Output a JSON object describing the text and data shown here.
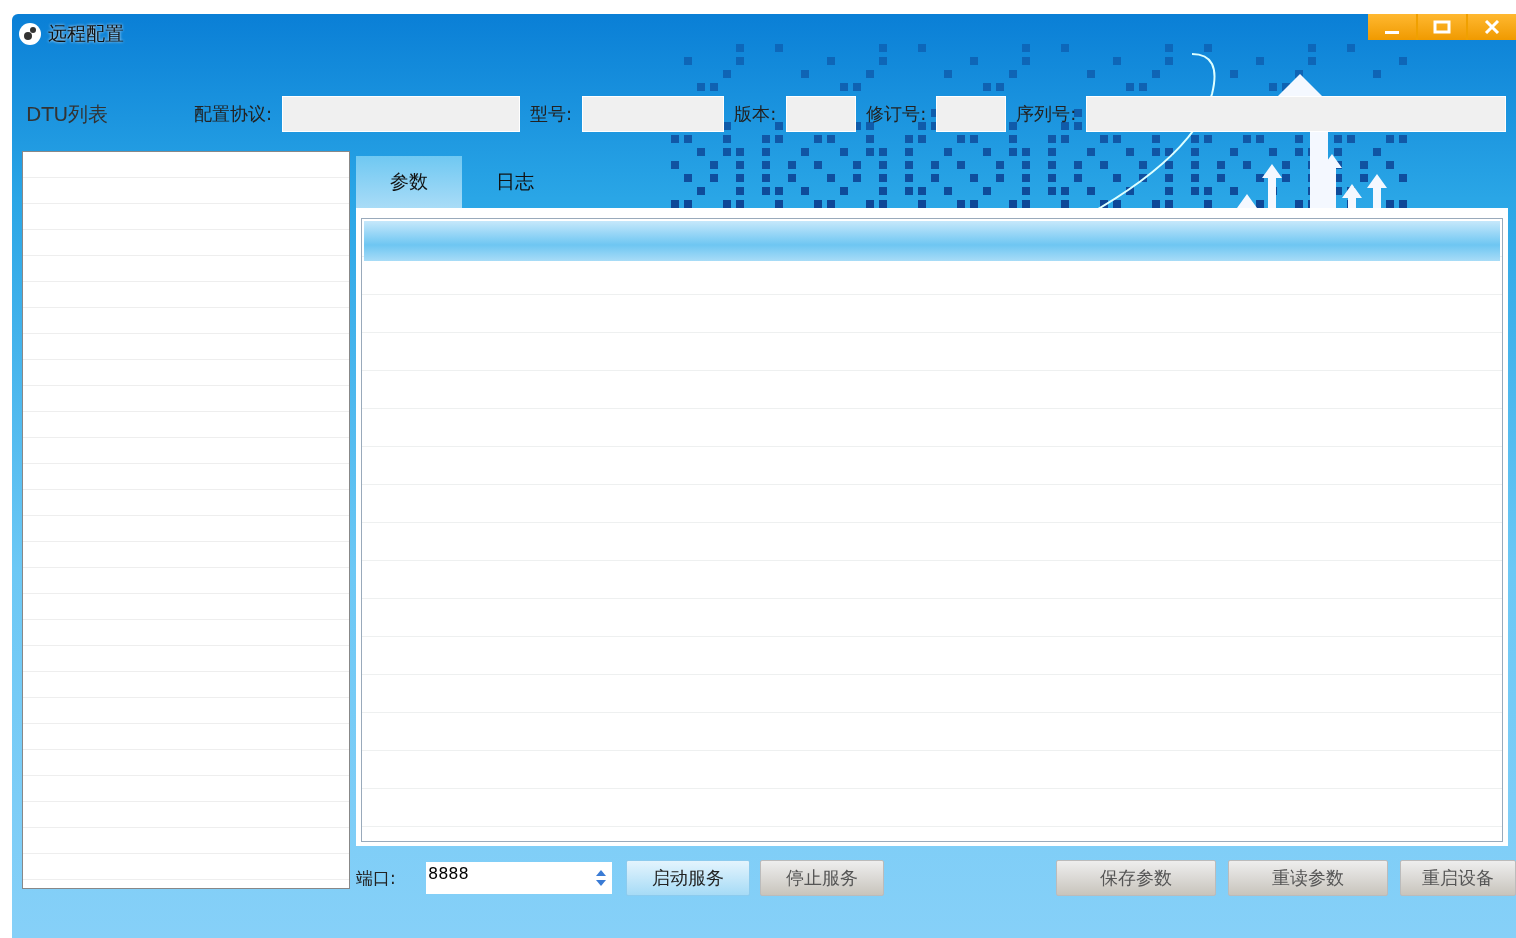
{
  "window": {
    "title": "远程配置"
  },
  "dtu_list": {
    "label": "DTU列表"
  },
  "fields": [
    {
      "label": "配置协议:"
    },
    {
      "label": "型号:"
    },
    {
      "label": "版本:"
    },
    {
      "label": "修订号:"
    },
    {
      "label": "序列号:"
    }
  ],
  "tabs": [
    {
      "label": "参数",
      "selected": true
    },
    {
      "label": "日志",
      "selected": false
    }
  ],
  "port": {
    "label": "端口:",
    "value": "8888"
  },
  "buttons": [
    {
      "label": "启动服务",
      "disabled": false
    },
    {
      "label": "停止服务",
      "disabled": true
    },
    {
      "label": "保存参数",
      "disabled": true
    },
    {
      "label": "重读参数",
      "disabled": true
    },
    {
      "label": "重启设备",
      "disabled": true
    }
  ]
}
